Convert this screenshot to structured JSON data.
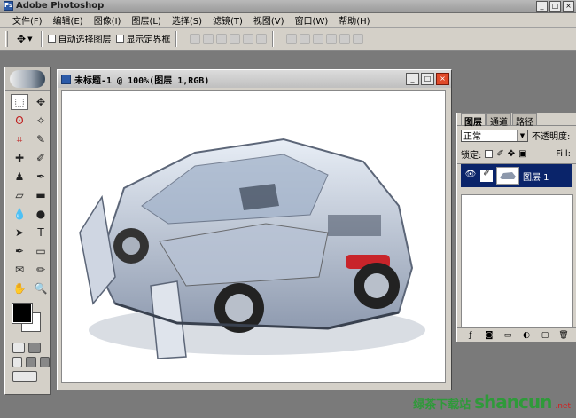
{
  "app": {
    "title": "Adobe Photoshop"
  },
  "menu": [
    "文件(F)",
    "编辑(E)",
    "图像(I)",
    "图层(L)",
    "选择(S)",
    "滤镜(T)",
    "视图(V)",
    "窗口(W)",
    "帮助(H)"
  ],
  "options": {
    "auto_select_label": "自动选择图层",
    "show_bounds_label": "显示定界框"
  },
  "document": {
    "title": "未标题-1 @ 100%(图层 1,RGB)"
  },
  "layers": {
    "tabs": [
      "图层",
      "通道",
      "路径"
    ],
    "blend_mode": "正常",
    "opacity_label": "不透明度:",
    "lock_label": "锁定:",
    "fill_label": "Fill:",
    "layer_name": "图层 1"
  },
  "watermark": {
    "cn": "绿茶下载站",
    "en": "shancun",
    "net": ".net"
  },
  "colors": {
    "accent": "#0a246a",
    "close": "#e04a2a",
    "watermark_green": "#2f9a3a"
  }
}
